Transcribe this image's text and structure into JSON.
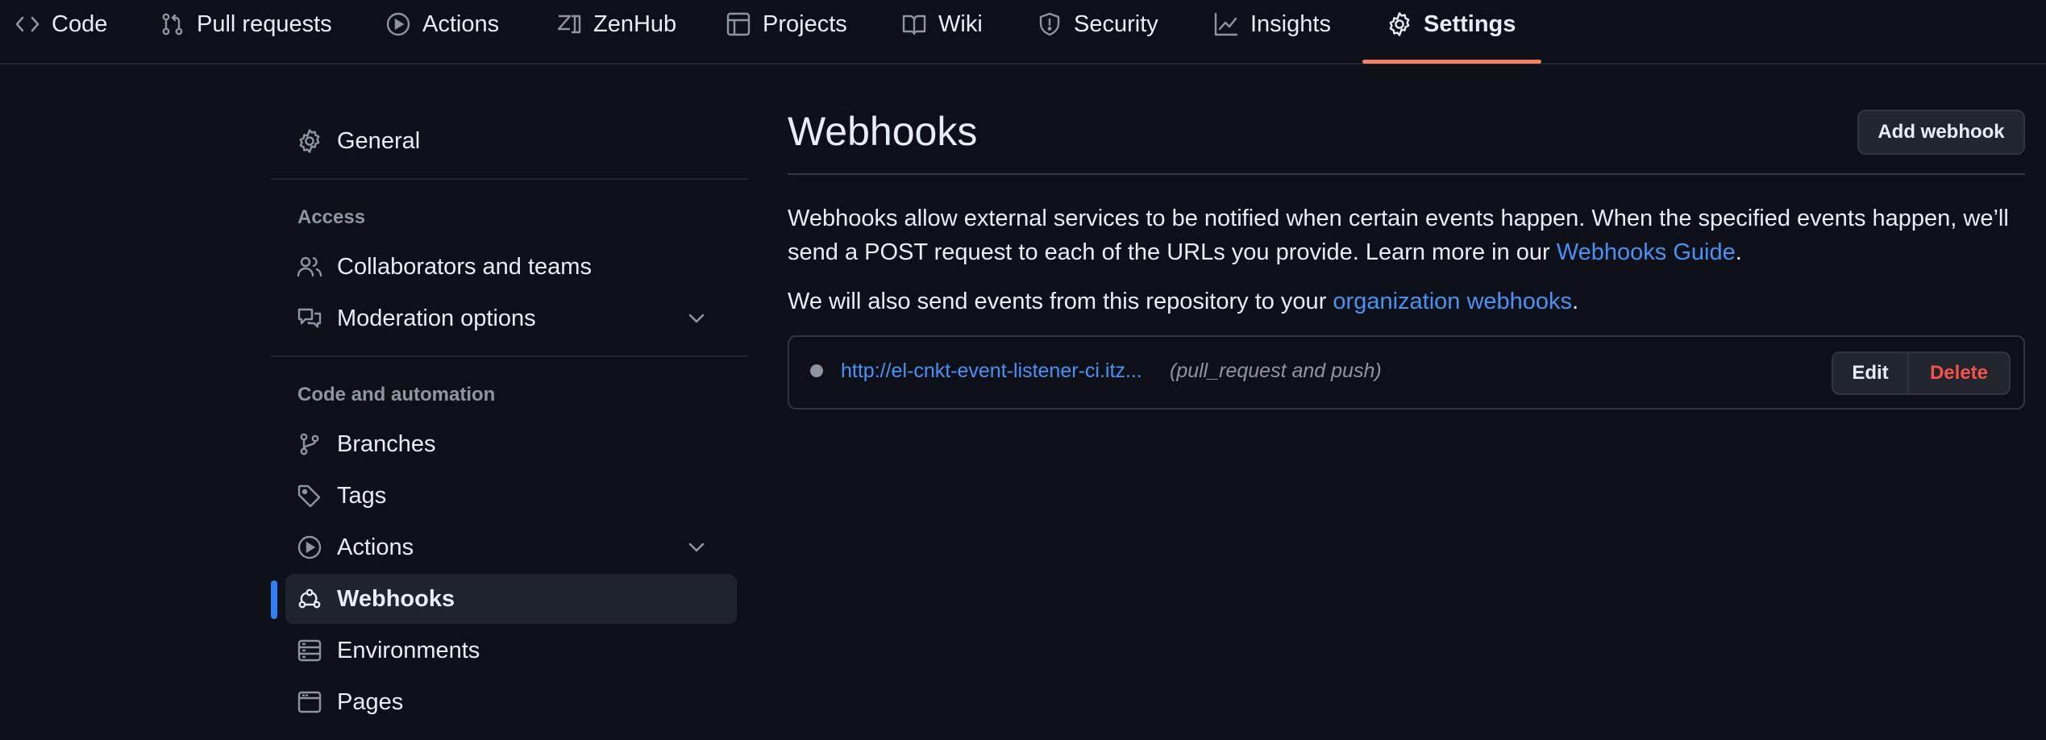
{
  "topnav": {
    "tabs": [
      {
        "label": "Code",
        "icon": "code-icon"
      },
      {
        "label": "Pull requests",
        "icon": "git-pull-request-icon"
      },
      {
        "label": "Actions",
        "icon": "play-icon"
      },
      {
        "label": "ZenHub",
        "icon": "zenhub-icon"
      },
      {
        "label": "Projects",
        "icon": "table-icon"
      },
      {
        "label": "Wiki",
        "icon": "book-icon"
      },
      {
        "label": "Security",
        "icon": "shield-icon"
      },
      {
        "label": "Insights",
        "icon": "graph-icon"
      },
      {
        "label": "Settings",
        "icon": "gear-icon"
      }
    ],
    "active_tab": "Settings",
    "active_color": "#f78166"
  },
  "sidebar": {
    "general": {
      "label": "General",
      "icon": "gear-icon"
    },
    "access_heading": "Access",
    "access_items": [
      {
        "label": "Collaborators and teams",
        "icon": "people-icon"
      },
      {
        "label": "Moderation options",
        "icon": "comment-discussion-icon",
        "expandable": true
      }
    ],
    "automation_heading": "Code and automation",
    "automation_items": [
      {
        "label": "Branches",
        "icon": "git-branch-icon"
      },
      {
        "label": "Tags",
        "icon": "tag-icon"
      },
      {
        "label": "Actions",
        "icon": "play-icon",
        "expandable": true
      },
      {
        "label": "Webhooks",
        "icon": "webhook-icon",
        "selected": true
      },
      {
        "label": "Environments",
        "icon": "server-icon"
      },
      {
        "label": "Pages",
        "icon": "browser-icon"
      }
    ],
    "selected_color": "#2f81f7"
  },
  "main": {
    "title": "Webhooks",
    "add_button": "Add webhook",
    "description": {
      "text": "Webhooks allow external services to be notified when certain events happen. When the specified events happen, we’ll send a POST request to each of the URLs you provide. Learn more in our ",
      "link": "Webhooks Guide",
      "suffix": "."
    },
    "org_note": {
      "text": "We will also send events from this repository to your ",
      "link": "organization webhooks",
      "suffix": "."
    },
    "webhooks": [
      {
        "url": "http://el-cnkt-event-listener-ci.itz...",
        "events": "(pull_request and push)",
        "edit_label": "Edit",
        "delete_label": "Delete"
      }
    ]
  }
}
